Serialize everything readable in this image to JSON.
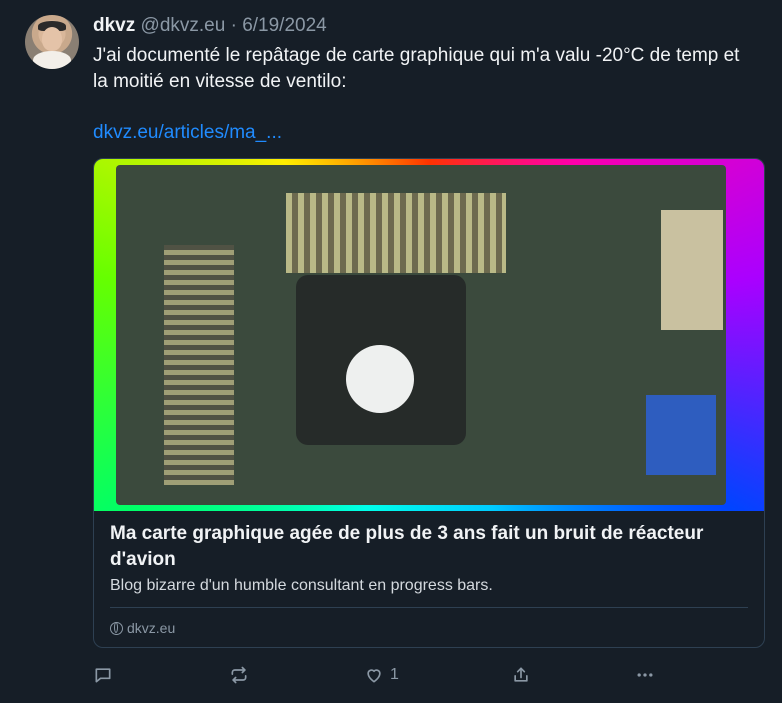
{
  "post": {
    "author_name": "dkvz",
    "handle": "@dkvz.eu",
    "separator": "·",
    "date": "6/19/2024",
    "text": "J'ai documenté le repâtage de carte graphique qui m'a valu -20°C de temp et la moitié en vitesse de ventilo:",
    "link_text": "dkvz.eu/articles/ma_..."
  },
  "card": {
    "image_alt": "graphics card photo with rainbow border",
    "title": "Ma carte graphique agée de plus de 3 ans fait un bruit de réacteur d'avion",
    "description": "Blog bizarre d'un humble consultant en progress bars.",
    "domain": "dkvz.eu"
  },
  "actions": {
    "reply_icon": "speech-bubble-icon",
    "repost_icon": "repost-icon",
    "like_icon": "heart-icon",
    "like_count": "1",
    "share_icon": "share-icon",
    "more_icon": "more-dots-icon"
  },
  "colors": {
    "background": "#161e27",
    "link": "#208bfe",
    "muted": "#8b98a5",
    "card_border": "#2e4052"
  }
}
